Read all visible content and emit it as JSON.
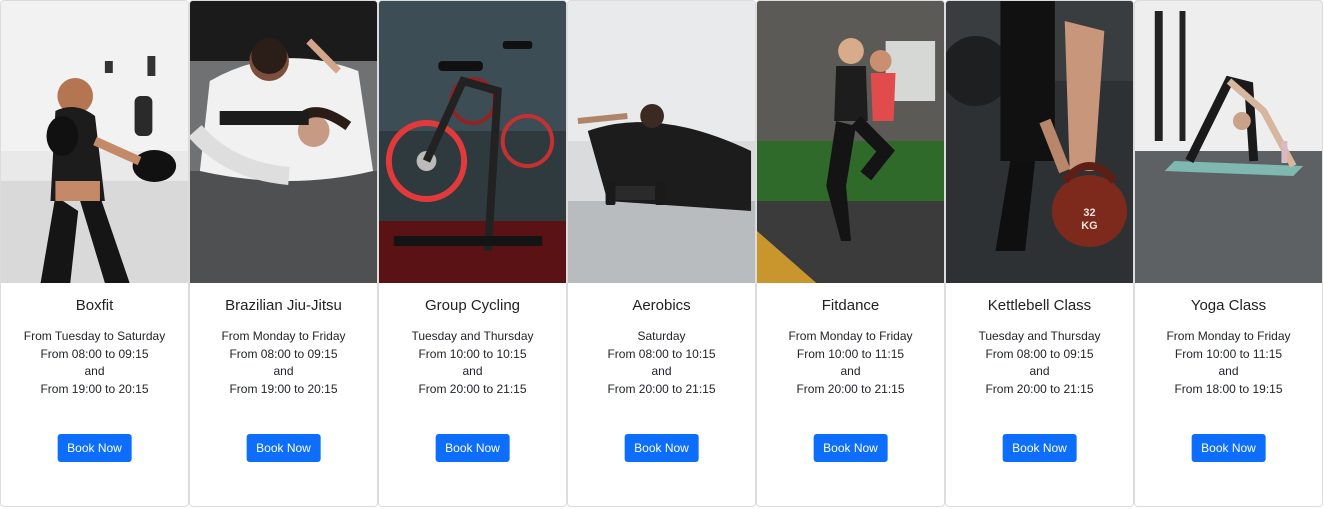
{
  "classes": [
    {
      "title": "Boxfit",
      "schedule": [
        "From Tuesday to Saturday",
        "From 08:00 to 09:15",
        "and",
        "From 19:00 to 20:15"
      ],
      "button": "Book Now",
      "photo": "boxing-woman-photo"
    },
    {
      "title": "Brazilian Jiu-Jitsu",
      "schedule": [
        "From Monday to Friday",
        "From 08:00 to 09:15",
        "and",
        "From 19:00 to 20:15"
      ],
      "button": "Book Now",
      "photo": "jiu-jitsu-grappling-photo"
    },
    {
      "title": "Group Cycling",
      "schedule": [
        "Tuesday and Thursday",
        "From 10:00 to 10:15",
        "and",
        "From 20:00 to 21:15"
      ],
      "button": "Book Now",
      "photo": "spin-bike-photo"
    },
    {
      "title": "Aerobics",
      "schedule": [
        "Saturday",
        "From 08:00 to 10:15",
        "and",
        "From 20:00 to 21:15"
      ],
      "button": "Book Now",
      "photo": "floor-exercise-photo"
    },
    {
      "title": "Fitdance",
      "schedule": [
        "From Monday to Friday",
        "From 10:00 to 11:15",
        "and",
        "From 20:00 to 21:15"
      ],
      "button": "Book Now",
      "photo": "dancing-women-photo"
    },
    {
      "title": "Kettlebell Class",
      "schedule": [
        "Tuesday and Thursday",
        "From 08:00 to 09:15",
        "and",
        "From 20:00 to 21:15"
      ],
      "button": "Book Now",
      "photo": "kettlebell-photo",
      "kettlebell_label": "32\nKG"
    },
    {
      "title": "Yoga Class",
      "schedule": [
        "From Monday to Friday",
        "From 10:00 to 11:15",
        "and",
        "From 18:00 to 19:15"
      ],
      "button": "Book Now",
      "photo": "yoga-pose-photo"
    }
  ],
  "colors": {
    "button_bg": "#0d6efd",
    "button_text": "#ffffff",
    "card_border": "#dcdcdc"
  }
}
